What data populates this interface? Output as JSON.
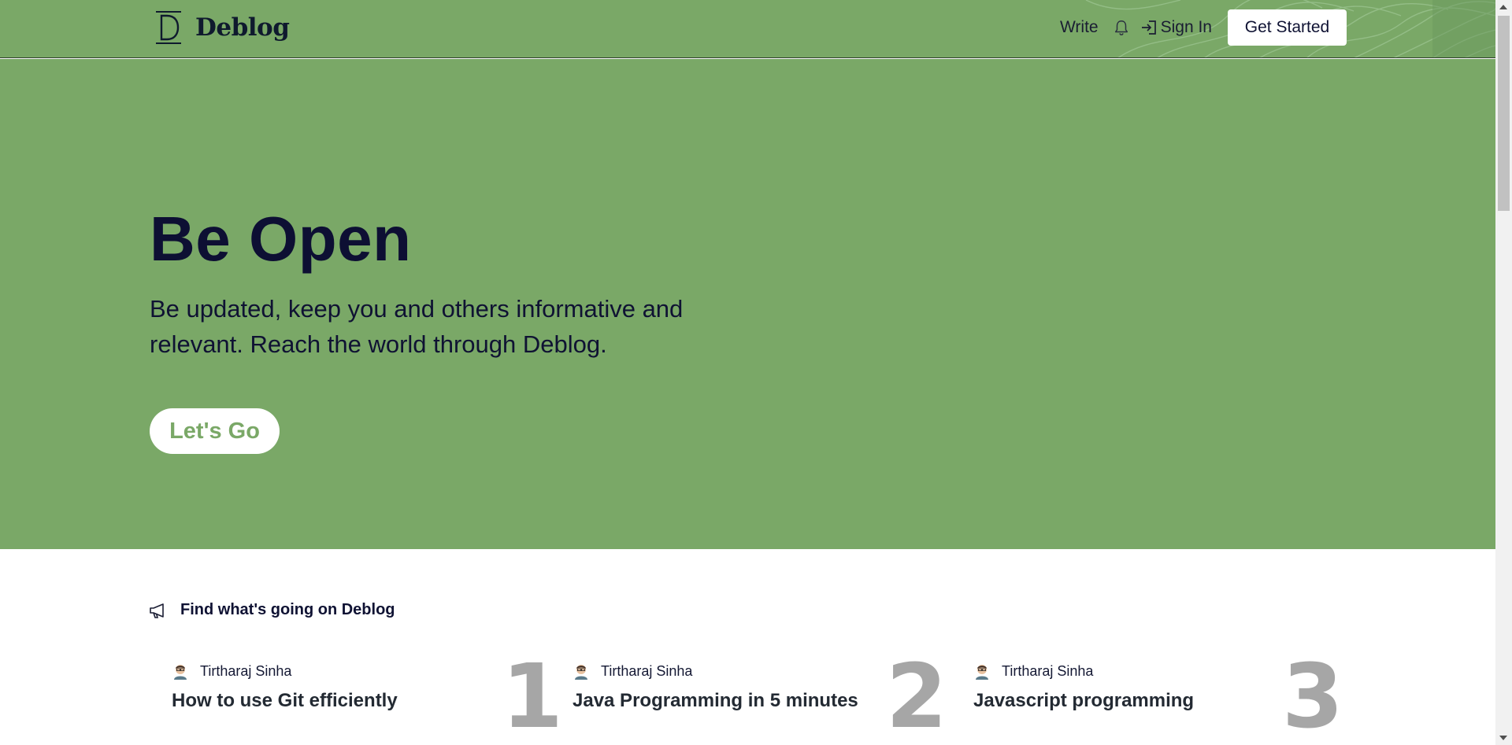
{
  "brand": {
    "name": "Deblog",
    "logo_letter": "D"
  },
  "nav": {
    "write_label": "Write",
    "signin_label": "Sign In",
    "cta_label": "Get Started"
  },
  "hero": {
    "title": "Be Open",
    "subtitle": "Be updated, keep you and others informative and relevant. Reach the world through Deblog.",
    "button_label": "Let's Go"
  },
  "trending": {
    "heading": "Find what's going on Deblog",
    "items": [
      {
        "rank": "1",
        "author": "Tirtharaj Sinha",
        "title": "How to use Git efficiently"
      },
      {
        "rank": "2",
        "author": "Tirtharaj Sinha",
        "title": "Java Programming in 5 minutes"
      },
      {
        "rank": "3",
        "author": "Tirtharaj Sinha",
        "title": "Javascript programming"
      }
    ]
  },
  "colors": {
    "brand_green": "#7aa867",
    "dark_navy": "#0d0f33",
    "rank_gray": "#a6a6a6"
  }
}
